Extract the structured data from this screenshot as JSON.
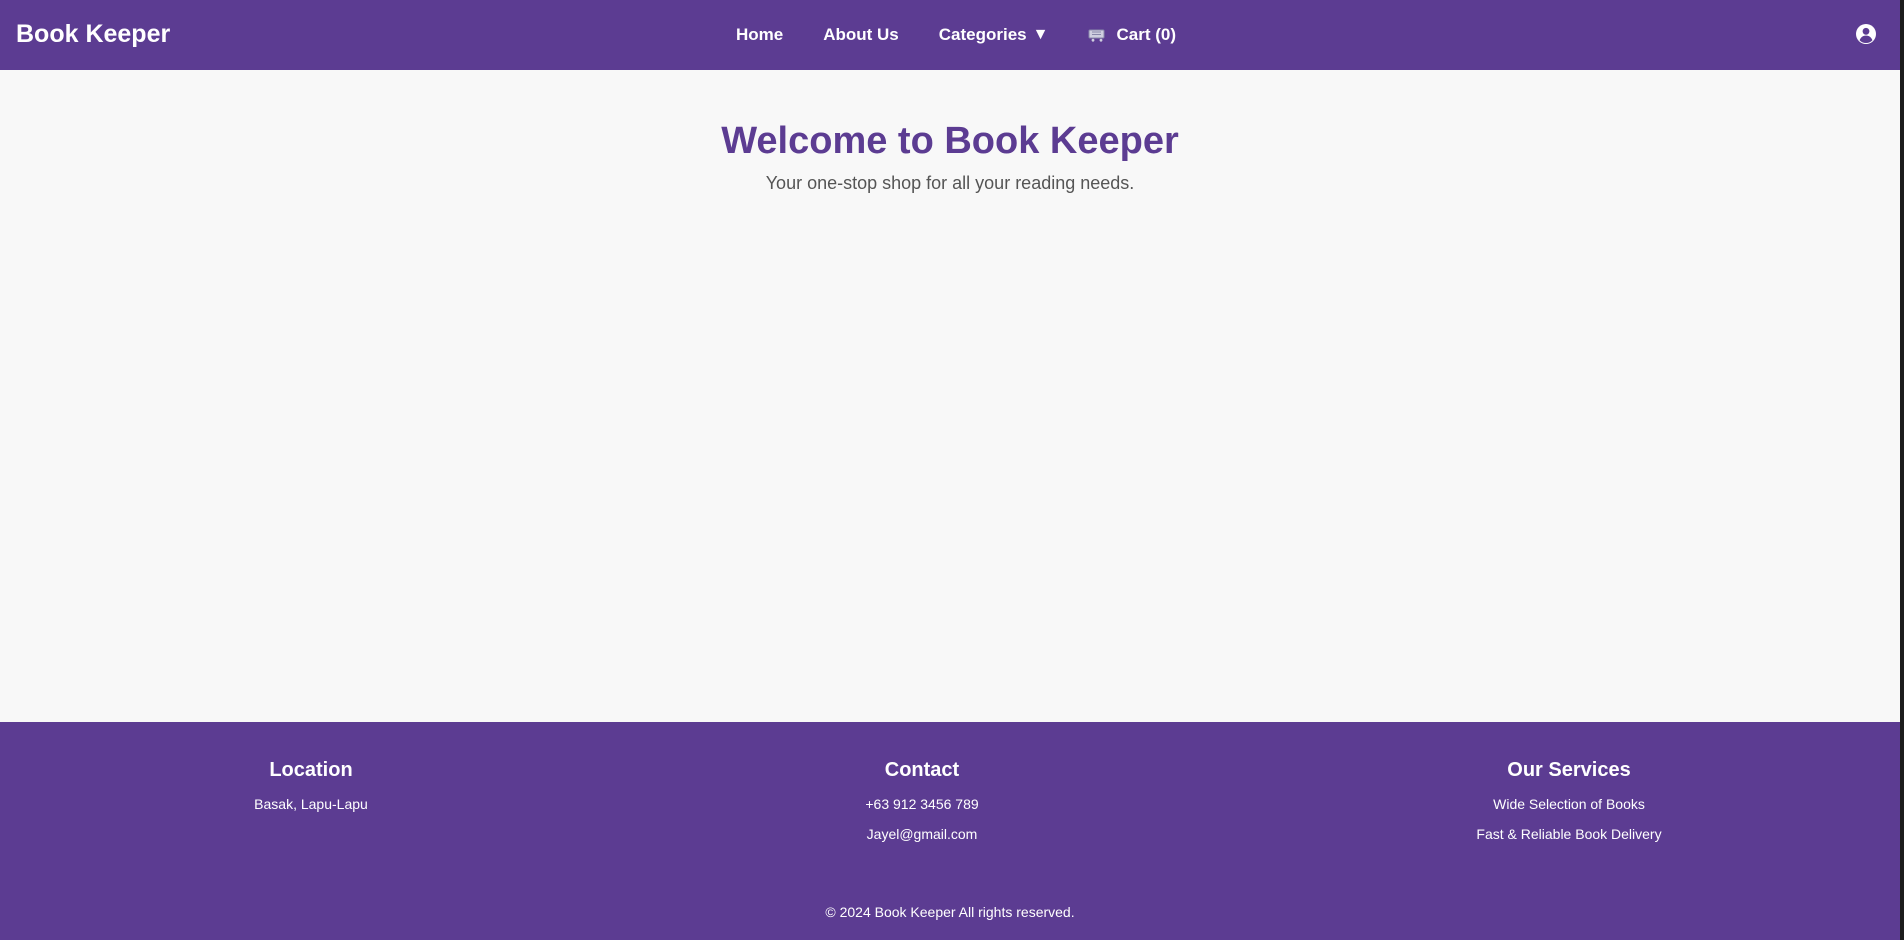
{
  "header": {
    "brand": "Book Keeper",
    "nav": {
      "home": "Home",
      "about": "About Us",
      "categories": "Categories",
      "categories_caret": "▼",
      "cart": "Cart (0)"
    },
    "icons": {
      "cart": "cart-icon",
      "user": "user-circle-icon"
    }
  },
  "hero": {
    "title": "Welcome to Book Keeper",
    "subtitle": "Your one-stop shop for all your reading needs."
  },
  "footer": {
    "location": {
      "heading": "Location",
      "lines": [
        "Basak, Lapu-Lapu"
      ]
    },
    "contact": {
      "heading": "Contact",
      "lines": [
        "+63 912 3456 789",
        "Jayel@gmail.com"
      ]
    },
    "services": {
      "heading": "Our Services",
      "lines": [
        "Wide Selection of Books",
        "Fast & Reliable Book Delivery"
      ]
    },
    "copyright": "© 2024 Book Keeper All rights reserved."
  },
  "colors": {
    "brand": "#5c3c92",
    "background": "#f8f8f8",
    "subtitle_text": "#555555"
  }
}
